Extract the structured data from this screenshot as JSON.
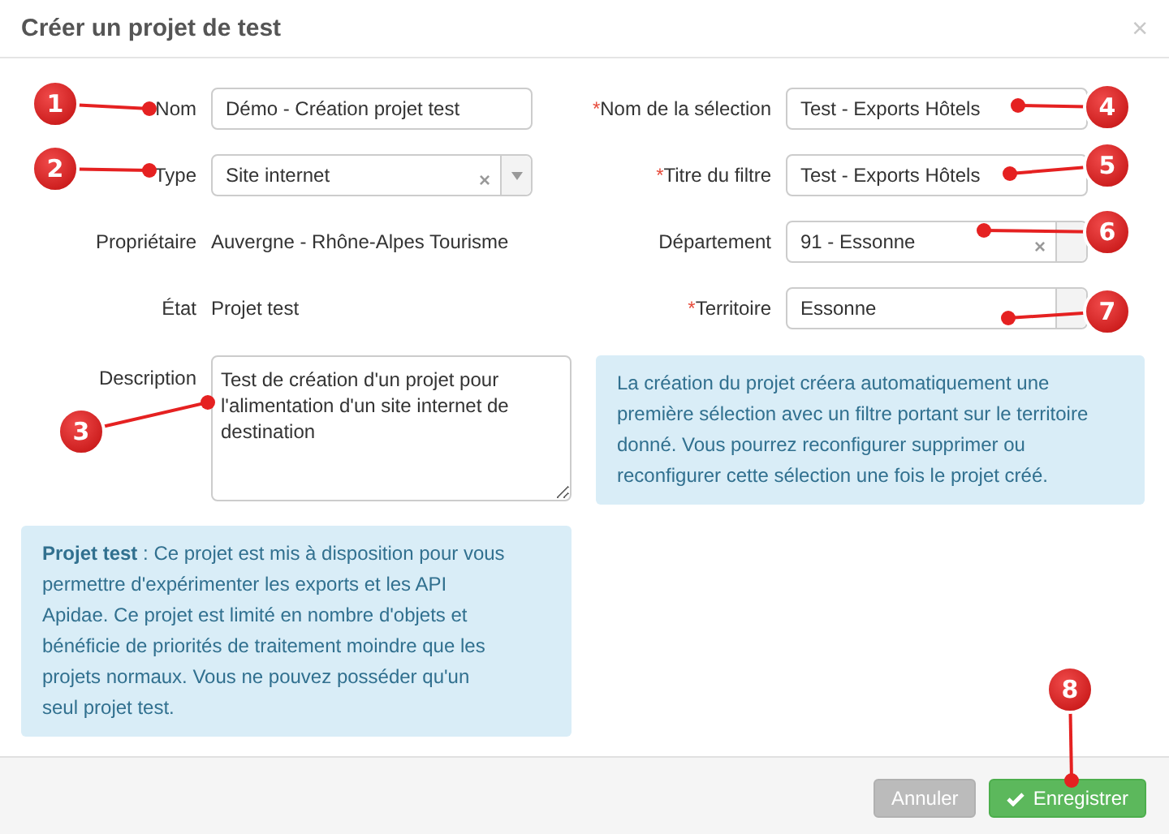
{
  "dialog": {
    "title": "Créer un projet de test",
    "close": "×"
  },
  "left_fields": [
    {
      "kind": "text",
      "label": "Nom",
      "value": "Démo - Création projet test"
    },
    {
      "kind": "select",
      "label": "Type",
      "value": "Site internet",
      "clear": "×",
      "arrow": true
    },
    {
      "kind": "static",
      "label": "Propriétaire",
      "value": "Auvergne - Rhône-Alpes Tourisme"
    },
    {
      "kind": "static",
      "label": "État",
      "value": "Projet test"
    },
    {
      "kind": "textarea",
      "label": "Description",
      "value": "Test de création d'un projet pour l'alimentation d'un site internet de destination"
    }
  ],
  "left_info": "**Projet test** : Ce projet est mis à disposition pour vous permettre d'expérimenter les exports et les API Apidae. Ce projet est limité en nombre d'objets et bénéficie de priorités de traitement moindre que les projets normaux. Vous ne pouvez posséder qu'un seul projet test.",
  "right_fields": [
    {
      "kind": "text",
      "label": "Nom de la sélection",
      "required": true,
      "value": "Test - Exports Hôtels"
    },
    {
      "kind": "text",
      "label": "Titre du filtre",
      "required": true,
      "value": "Test - Exports Hôtels"
    },
    {
      "kind": "select",
      "label": "Département",
      "required": false,
      "value": "91 - Essonne",
      "clear": "×"
    },
    {
      "kind": "select",
      "label": "Territoire",
      "required": true,
      "value": "Essonne"
    }
  ],
  "required_mark": "*",
  "right_info": "La création du projet créera automatiquement une première sélection avec un filtre portant sur le territoire donné. Vous pourrez reconfigurer supprimer ou reconfigurer cette sélection une fois le projet créé.",
  "buttons": [
    {
      "kind": "cancel",
      "label": "Annuler",
      "disabled": true
    },
    {
      "kind": "save",
      "label": "Enregistrer",
      "disabled": false
    }
  ],
  "callouts": [
    "1",
    "2",
    "3",
    "4",
    "5",
    "6",
    "7",
    "8"
  ]
}
